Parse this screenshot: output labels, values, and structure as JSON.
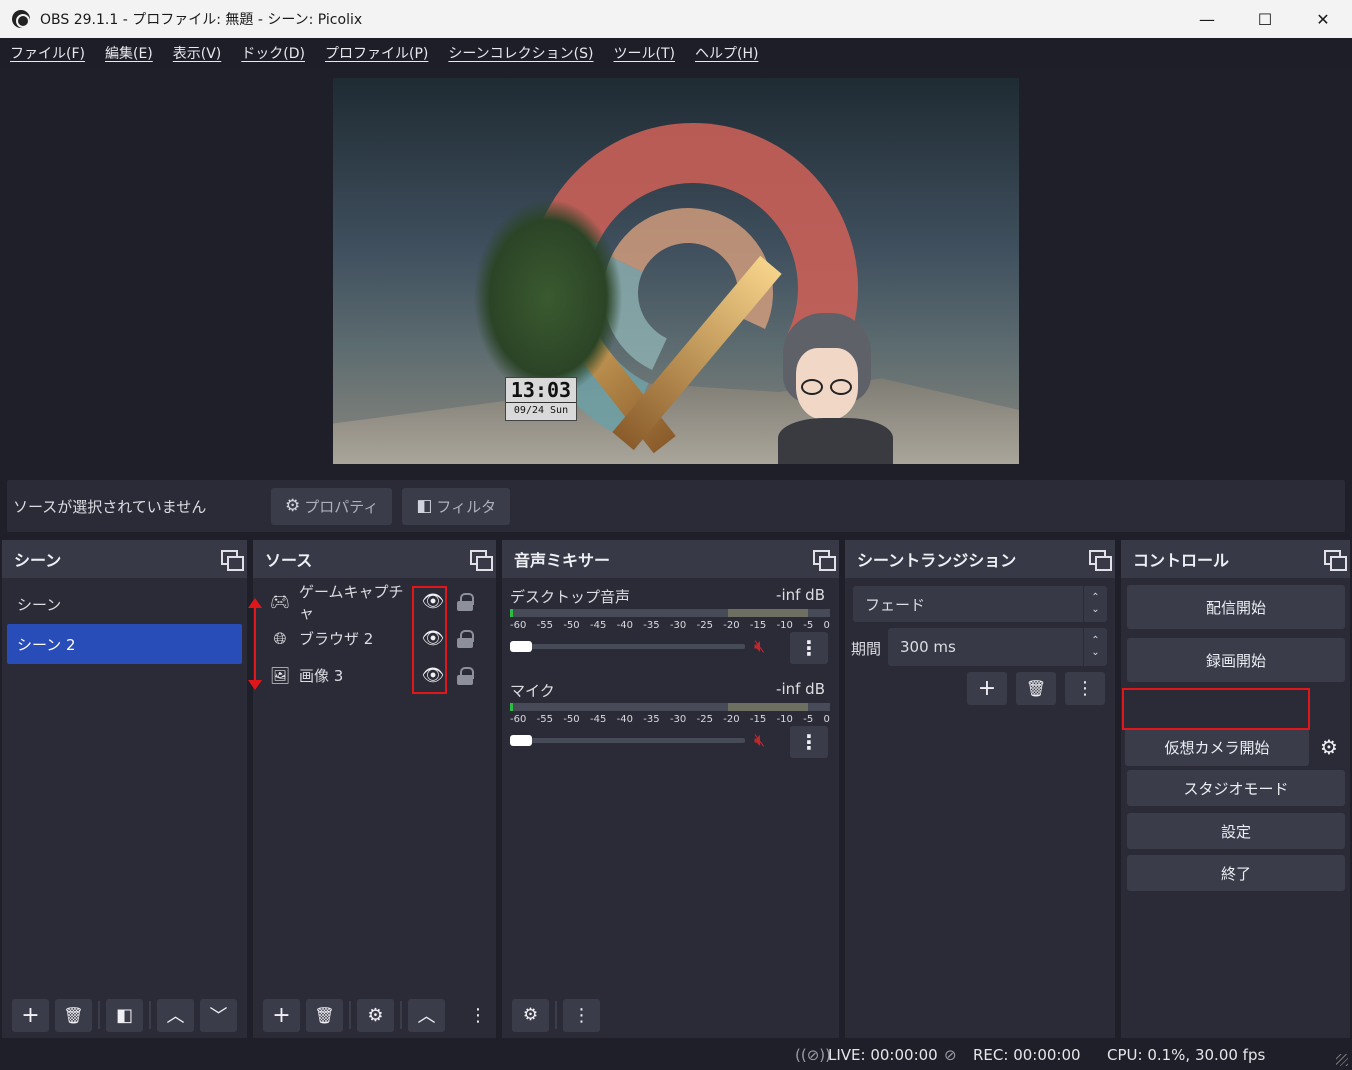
{
  "window": {
    "title": "OBS 29.1.1 - プロファイル: 無題 - シーン: Picolix",
    "minimize": "—",
    "maximize": "☐",
    "close": "✕"
  },
  "menu": [
    "ファイル(F)",
    "編集(E)",
    "表示(V)",
    "ドック(D)",
    "プロファイル(P)",
    "シーンコレクション(S)",
    "ツール(T)",
    "ヘルプ(H)"
  ],
  "preview": {
    "clock_time": "13:03",
    "clock_date": "09/24 Sun"
  },
  "source_status": {
    "text": "ソースが選択されていません",
    "properties_label": "プロパティ",
    "filters_label": "フィルタ"
  },
  "scenes": {
    "title": "シーン",
    "items": [
      "シーン",
      "シーン 2"
    ],
    "selected_index": 1
  },
  "sources": {
    "title": "ソース",
    "items": [
      {
        "label": "ゲームキャプチャ",
        "icon": "gamepad-icon"
      },
      {
        "label": "ブラウザ 2",
        "icon": "globe-icon"
      },
      {
        "label": "画像 3",
        "icon": "image-icon"
      }
    ]
  },
  "mixer": {
    "title": "音声ミキサー",
    "channels": [
      {
        "name": "デスクトップ音声",
        "level": "-inf dB",
        "volume": 0.03,
        "muted": true
      },
      {
        "name": "マイク",
        "level": "-inf dB",
        "volume": 0.03,
        "muted": true
      }
    ],
    "ticks": [
      "-60",
      "-55",
      "-50",
      "-45",
      "-40",
      "-35",
      "-30",
      "-25",
      "-20",
      "-15",
      "-10",
      "-5",
      "0"
    ]
  },
  "transitions": {
    "title": "シーントランジション",
    "selected": "フェード",
    "duration_label": "期間",
    "duration_value": "300 ms"
  },
  "controls": {
    "title": "コントロール",
    "start_streaming": "配信開始",
    "start_recording": "録画開始",
    "start_virtual_camera": "仮想カメラ開始",
    "studio_mode": "スタジオモード",
    "settings": "設定",
    "exit": "終了"
  },
  "statusbar": {
    "live": "LIVE: 00:00:00",
    "rec": "REC: 00:00:00",
    "cpu": "CPU: 0.1%, 30.00 fps"
  },
  "colors": {
    "annotation_red": "#e0161b",
    "selected_scene": "#284cb8",
    "mute_red": "#c2262c"
  }
}
